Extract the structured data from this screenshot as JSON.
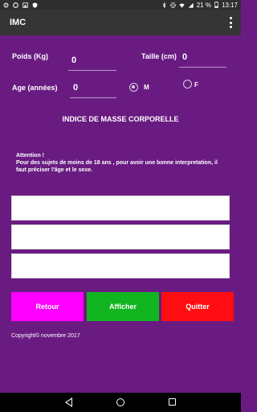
{
  "status_bar": {
    "battery": "21 %",
    "time": "13:17",
    "left_icons": [
      "settings-icon",
      "circle-icon",
      "image-icon",
      "shield-icon"
    ],
    "right_icons": [
      "bluetooth-icon",
      "vibrate-icon",
      "wifi-icon",
      "signal-icon",
      "battery-icon"
    ]
  },
  "app_bar": {
    "title": "IMC",
    "menu_icon": "more-vert-icon"
  },
  "form": {
    "weight_label": "Poids (Kg)",
    "weight_value": "0",
    "height_label": "Taille (cm)",
    "height_value": "0",
    "age_label": "Age (années)",
    "age_value": "0",
    "sex_male_label": "M",
    "sex_female_label": "F",
    "sex_selected": "M"
  },
  "heading": "INDICE DE MASSE CORPORELLE",
  "notice": {
    "title": "Attention !",
    "body": "Pour des sujets de moins de 18 ans , pour avoir une bonne interpretation, il faut préciser l'âge et le sexe."
  },
  "results": [
    "",
    "",
    ""
  ],
  "buttons": {
    "back_label": "Retour",
    "back_color": "#ff00ff",
    "show_label": "Afficher",
    "show_color": "#11b520",
    "quit_label": "Quitter",
    "quit_color": "#ff0d12"
  },
  "footer": {
    "copyright": "Copyright© novembre 2017"
  },
  "colors": {
    "background": "#6a1b82",
    "app_bar": "#353535",
    "status_bar": "#2e2e2e"
  }
}
